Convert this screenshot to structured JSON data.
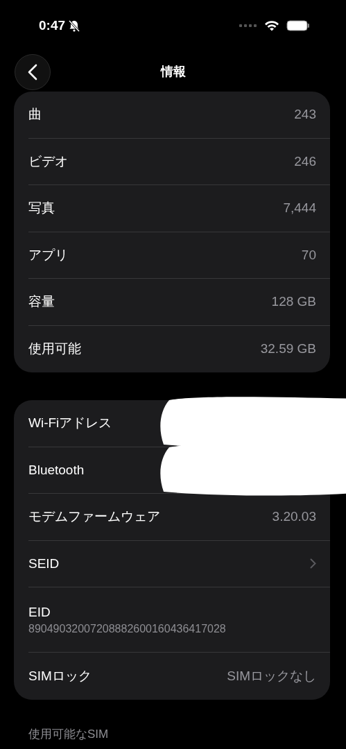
{
  "status_bar": {
    "time": "0:47",
    "silent": true
  },
  "nav": {
    "title": "情報"
  },
  "groups": [
    {
      "rows": [
        {
          "kind": "value",
          "label": "曲",
          "value": "243"
        },
        {
          "kind": "value",
          "label": "ビデオ",
          "value": "246"
        },
        {
          "kind": "value",
          "label": "写真",
          "value": "7,444"
        },
        {
          "kind": "value",
          "label": "アプリ",
          "value": "70"
        },
        {
          "kind": "value",
          "label": "容量",
          "value": "128 GB"
        },
        {
          "kind": "value",
          "label": "使用可能",
          "value": "32.59 GB"
        }
      ]
    },
    {
      "rows": [
        {
          "kind": "redacted",
          "label": "Wi-Fiアドレス"
        },
        {
          "kind": "redacted",
          "label": "Bluetooth"
        },
        {
          "kind": "value",
          "label": "モデムファームウェア",
          "value": "3.20.03"
        },
        {
          "kind": "chevron",
          "label": "SEID"
        },
        {
          "kind": "stacked",
          "label": "EID",
          "value": "89049032007208882600160436417028"
        },
        {
          "kind": "value",
          "label": "SIMロック",
          "value": "SIMロックなし"
        }
      ]
    },
    {
      "header": "使用可能なSIM"
    }
  ]
}
